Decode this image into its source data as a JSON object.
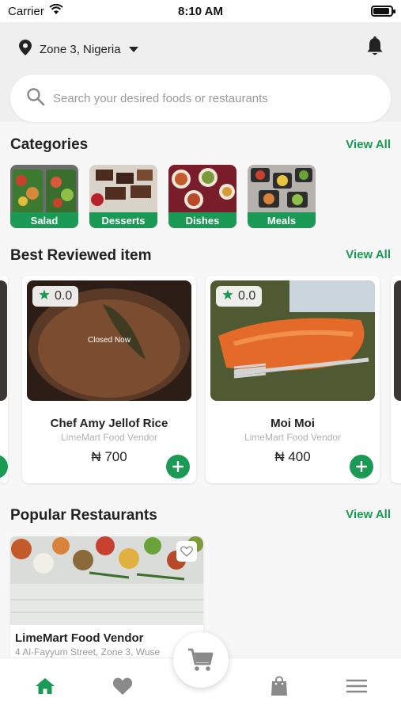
{
  "status_bar": {
    "carrier": "Carrier",
    "time": "8:10 AM",
    "battery_level": 0.9
  },
  "header": {
    "location": "Zone 3, Nigeria",
    "search_placeholder": "Search your desired foods or restaurants"
  },
  "categories": {
    "title": "Categories",
    "view_all": "View All",
    "items": [
      {
        "label": "Salad"
      },
      {
        "label": "Desserts"
      },
      {
        "label": "Dishes"
      },
      {
        "label": "Meals"
      }
    ]
  },
  "best_reviewed": {
    "title": "Best Reviewed item",
    "view_all": "View All",
    "items": [
      {
        "rating": "0.0",
        "status": "Closed Now",
        "name": "Chef Amy Jellof Rice",
        "vendor": "LimeMart Food Vendor",
        "price": "₦ 700"
      },
      {
        "rating": "0.0",
        "name": "Moi Moi",
        "vendor": "LimeMart Food Vendor",
        "price": "₦ 400"
      }
    ]
  },
  "popular_restaurants": {
    "title": "Popular Restaurants",
    "view_all": "View All",
    "items": [
      {
        "name": "LimeMart Food Vendor",
        "address": "4 Al-Fayyum Street, Zone 3, Wuse"
      }
    ]
  },
  "bottom_nav": {
    "items": [
      {
        "icon": "home-icon",
        "active": true
      },
      {
        "icon": "heart-icon",
        "active": false
      },
      {
        "icon": "cart-icon",
        "active": false
      },
      {
        "icon": "bag-icon",
        "active": false
      },
      {
        "icon": "menu-icon",
        "active": false
      }
    ]
  },
  "colors": {
    "accent": "#1a9a54",
    "background": "#f7f7f7",
    "muted_text": "#b2b2b2"
  }
}
